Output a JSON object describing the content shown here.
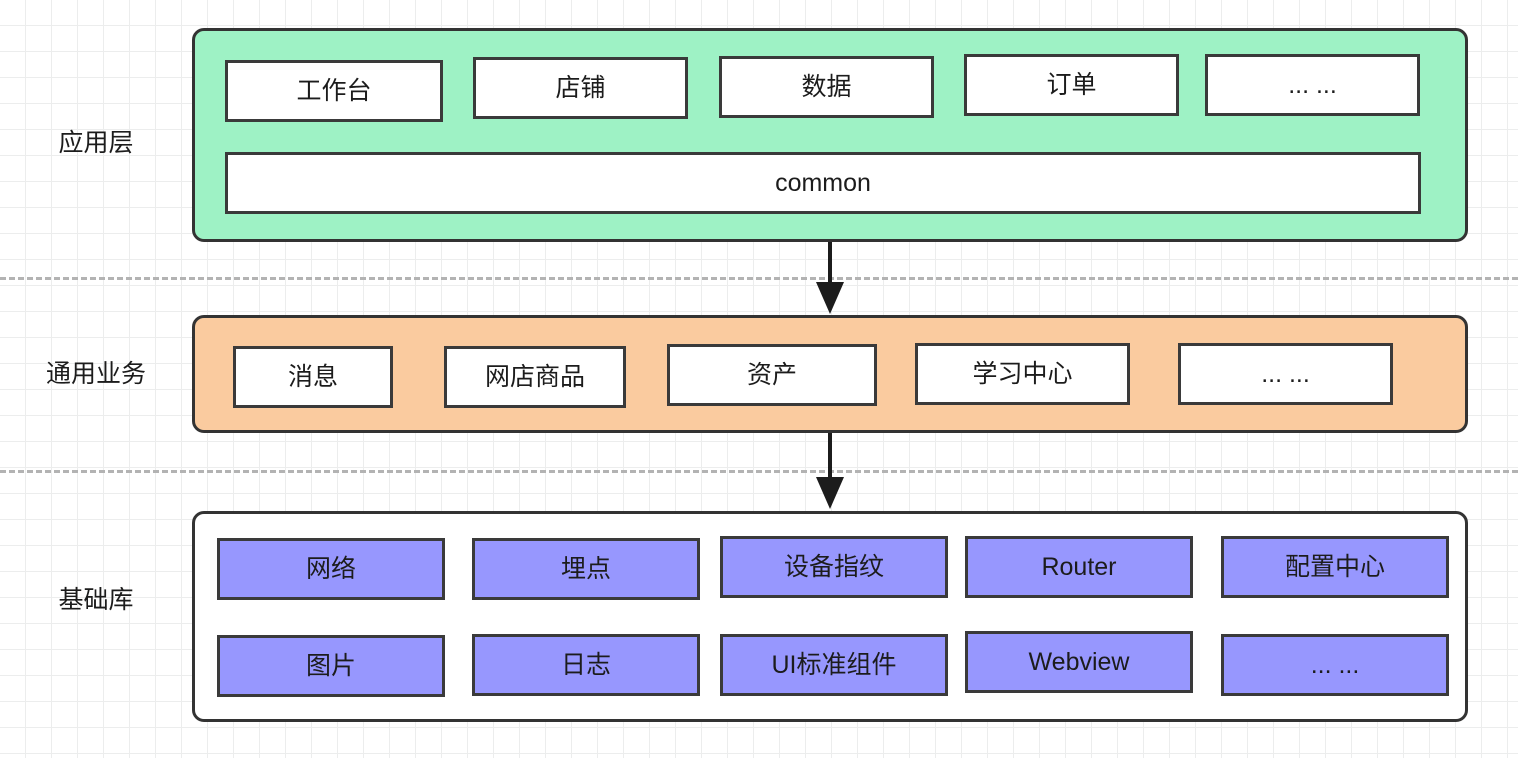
{
  "diagram": {
    "title": "Mobile app layered architecture diagram",
    "background": {
      "grid": "light-gray-square-grid",
      "grid_size_px": 26,
      "grid_color": "#eceded"
    },
    "colors": {
      "application_layer_fill": "#9EF2C5",
      "business_layer_fill": "#FACB9F",
      "base_library_fill": "#FFFFFF",
      "base_library_cell_fill": "#9797FE",
      "cell_fill": "#FFFFFF",
      "stroke": "#333333",
      "separator": "#B3B3B3",
      "text": "#1C1C1C"
    },
    "layers": [
      {
        "id": "application",
        "label": "应用层",
        "rows": [
          {
            "cells": [
              "工作台",
              "店铺",
              "数据",
              "订单",
              "... ..."
            ]
          },
          {
            "cells": [
              "common"
            ]
          }
        ]
      },
      {
        "id": "common-business",
        "label": "通用业务",
        "rows": [
          {
            "cells": [
              "消息",
              "网店商品",
              "资产",
              "学习中心",
              "... ..."
            ]
          }
        ]
      },
      {
        "id": "base-library",
        "label": "基础库",
        "rows": [
          {
            "cells": [
              "网络",
              "埋点",
              "设备指纹",
              "Router",
              "配置中心"
            ]
          },
          {
            "cells": [
              "图片",
              "日志",
              "UI标准组件",
              "Webview",
              "... ..."
            ]
          }
        ]
      }
    ],
    "separators": [
      {
        "id": "separator-app-business",
        "style": "dashed"
      },
      {
        "id": "separator-business-base",
        "style": "dashed"
      }
    ],
    "arrows": [
      {
        "id": "arrow-app-to-business",
        "from": "application",
        "to": "common-business",
        "direction": "down"
      },
      {
        "id": "arrow-business-to-base",
        "from": "common-business",
        "to": "base-library",
        "direction": "down"
      }
    ]
  }
}
